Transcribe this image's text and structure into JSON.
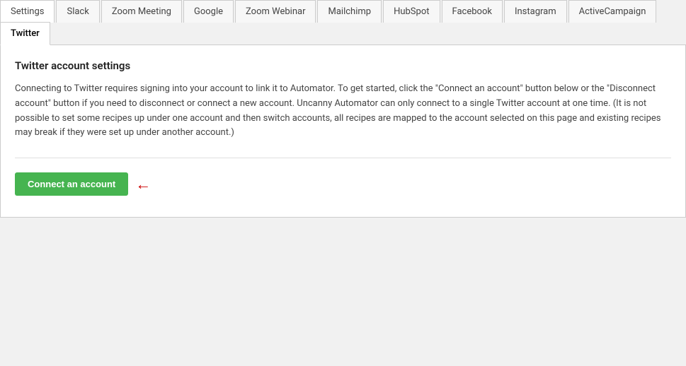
{
  "tabs": [
    {
      "label": "Settings",
      "active": false
    },
    {
      "label": "Slack",
      "active": false
    },
    {
      "label": "Zoom Meeting",
      "active": false
    },
    {
      "label": "Google",
      "active": false
    },
    {
      "label": "Zoom Webinar",
      "active": false
    },
    {
      "label": "Mailchimp",
      "active": false
    },
    {
      "label": "HubSpot",
      "active": false
    },
    {
      "label": "Facebook",
      "active": false
    },
    {
      "label": "Instagram",
      "active": false
    },
    {
      "label": "ActiveCampaign",
      "active": false
    },
    {
      "label": "Twitter",
      "active": true
    }
  ],
  "content": {
    "title": "Twitter account settings",
    "description": "Connecting to Twitter requires signing into your account to link it to Automator. To get started, click the \"Connect an account\" button below or the \"Disconnect account\" button if you need to disconnect or connect a new account. Uncanny Automator can only connect to a single Twitter account at one time. (It is not possible to set some recipes up under one account and then switch accounts, all recipes are mapped to the account selected on this page and existing recipes may break if they were set up under another account.)",
    "connect_button_label": "Connect an account",
    "arrow_symbol": "←"
  }
}
